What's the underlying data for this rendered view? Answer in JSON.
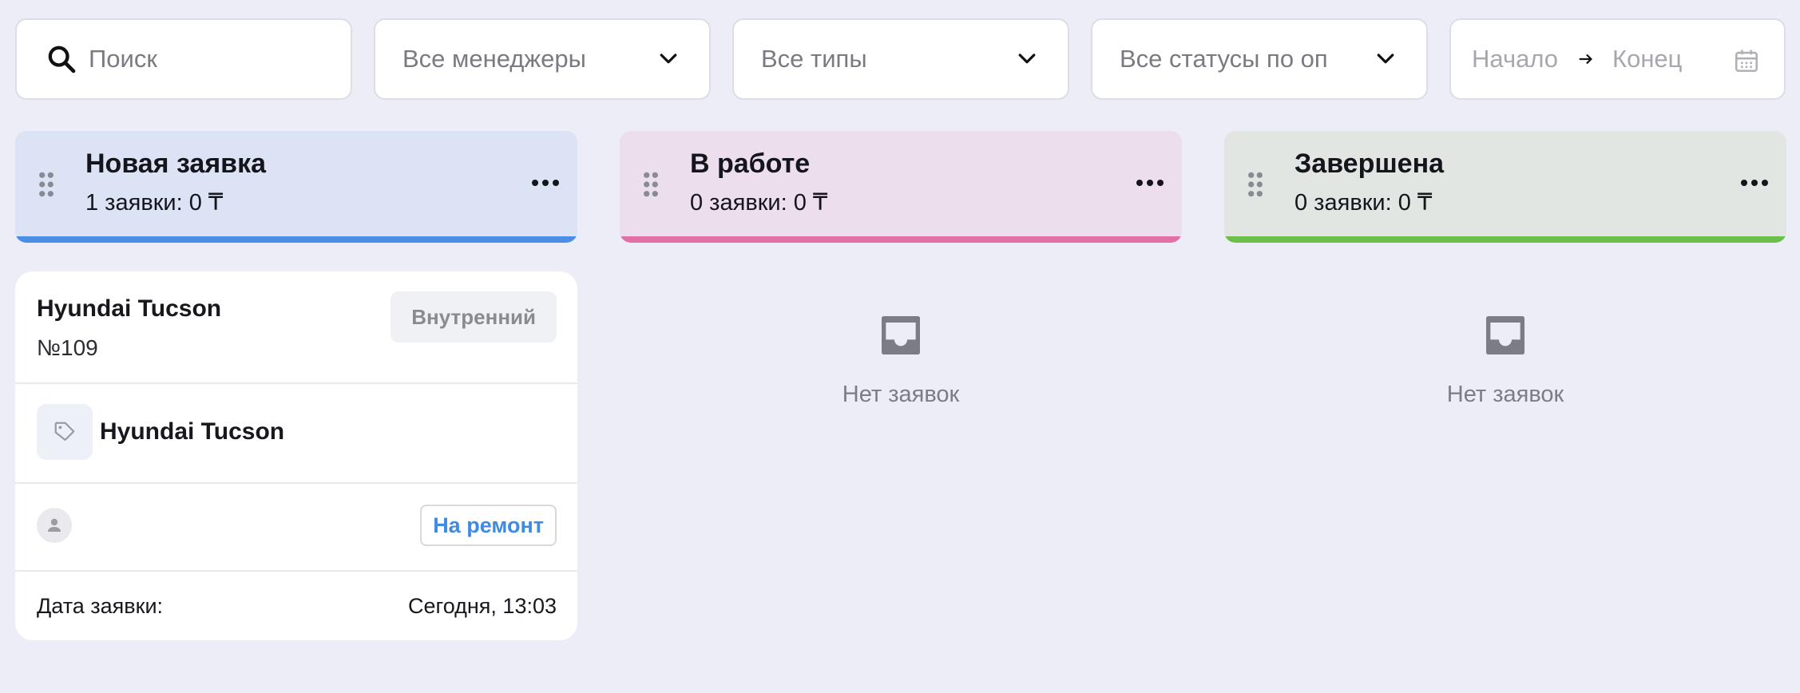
{
  "filters": {
    "search_placeholder": "Поиск",
    "managers": "Все менеджеры",
    "types": "Все типы",
    "statuses": "Все статусы по оп",
    "date_start": "Начало",
    "date_end": "Конец"
  },
  "columns": [
    {
      "title": "Новая заявка",
      "summary": "1 заявки: 0 ₸",
      "accent": "#4a8ee6",
      "background": "#dbe3f4"
    },
    {
      "title": "В работе",
      "summary": "0 заявки: 0 ₸",
      "accent": "#e070a6",
      "background": "#ecdeec"
    },
    {
      "title": "Завершена",
      "summary": "0 заявки: 0 ₸",
      "accent": "#6cc04a",
      "background": "#e1e6e3"
    }
  ],
  "card": {
    "title": "Hyundai Tucson",
    "number": "№109",
    "badge": "Внутренний",
    "model": "Hyundai Tucson",
    "action": "На ремонт",
    "date_label": "Дата заявки:",
    "date_value": "Сегодня, 13:03"
  },
  "empty_text": "Нет заявок",
  "icons": [
    "search-icon",
    "chevron-down-icon",
    "arrow-right-icon",
    "calendar-icon",
    "drag-handle-icon",
    "more-icon",
    "tag-icon",
    "user-icon",
    "inbox-icon"
  ]
}
